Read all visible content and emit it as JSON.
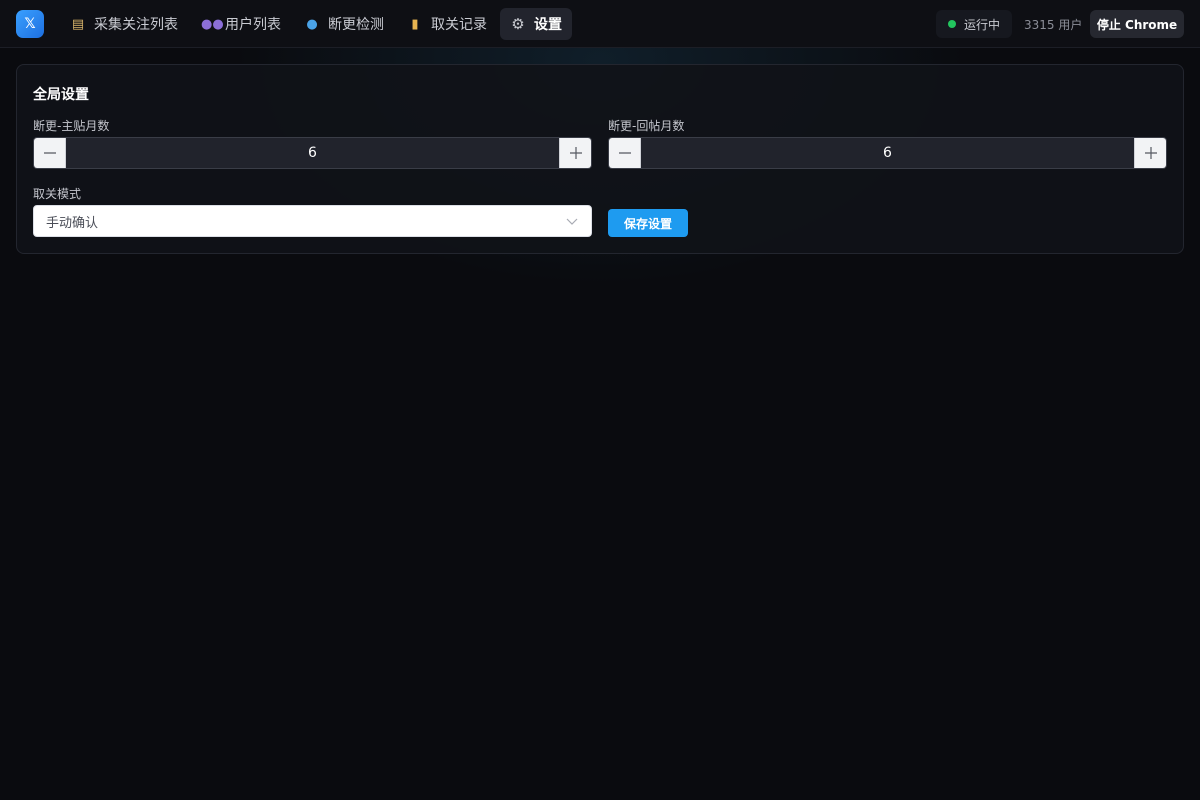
{
  "app": {
    "logo_glyph": "𝕏"
  },
  "nav": {
    "tabs": [
      {
        "icon": "clipboard-icon",
        "label": "采集关注列表"
      },
      {
        "icon": "users-icon",
        "label": "用户列表"
      },
      {
        "icon": "magnifier-icon",
        "label": "断更检测"
      },
      {
        "icon": "scroll-icon",
        "label": "取关记录"
      },
      {
        "icon": "gear-icon",
        "label": "设置",
        "active": true
      }
    ]
  },
  "status": {
    "label": "运行中",
    "color": "#22c55e"
  },
  "user_count": "3315 用户",
  "stop_button": "停止 Chrome",
  "settings": {
    "title": "全局设置",
    "main_post_months": {
      "label": "断更-主贴月数",
      "value": "6"
    },
    "reply_post_months": {
      "label": "断更-回帖月数",
      "value": "6"
    },
    "unfollow_mode": {
      "label": "取关模式",
      "selected": "手动确认"
    },
    "save_button": "保存设置"
  },
  "colors": {
    "accent": "#1e9bf0",
    "background": "#0a0b0f"
  }
}
